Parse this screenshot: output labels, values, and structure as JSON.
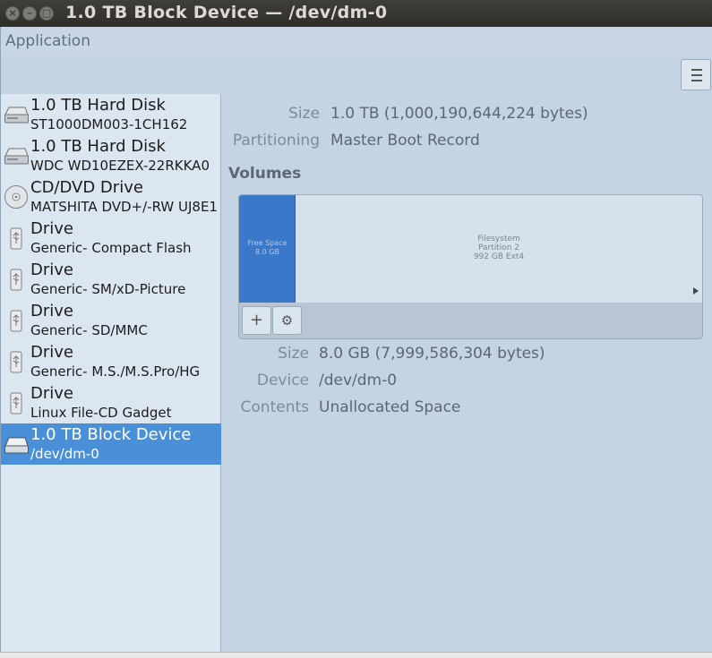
{
  "window": {
    "title": "1.0 TB Block Device — /dev/dm-0",
    "close_glyph": "×",
    "min_glyph": "–",
    "max_glyph": "□"
  },
  "menubar": {
    "application": "Application"
  },
  "sidebar": {
    "devices": [
      {
        "name": "1.0 TB Hard Disk",
        "sub": "ST1000DM003-1CH162",
        "icon": "hard-disk-icon"
      },
      {
        "name": "1.0 TB Hard Disk",
        "sub": "WDC WD10EZEX-22RKKA0",
        "icon": "hard-disk-icon"
      },
      {
        "name": "CD/DVD Drive",
        "sub": "MATSHITA DVD+/-RW UJ8E1",
        "icon": "optical-disc-icon"
      },
      {
        "name": "Drive",
        "sub": "Generic- Compact Flash",
        "icon": "usb-drive-icon"
      },
      {
        "name": "Drive",
        "sub": "Generic- SM/xD-Picture",
        "icon": "usb-drive-icon"
      },
      {
        "name": "Drive",
        "sub": "Generic- SD/MMC",
        "icon": "usb-drive-icon"
      },
      {
        "name": "Drive",
        "sub": "Generic- M.S./M.S.Pro/HG",
        "icon": "usb-drive-icon"
      },
      {
        "name": "Drive",
        "sub": "Linux File-CD Gadget",
        "icon": "usb-drive-icon"
      },
      {
        "name": "1.0 TB Block Device",
        "sub": "/dev/dm-0",
        "icon": "block-device-icon",
        "selected": true
      }
    ]
  },
  "details": {
    "size_label": "Size",
    "size_value": "1.0 TB (1,000,190,644,224 bytes)",
    "partitioning_label": "Partitioning",
    "partitioning_value": "Master Boot Record",
    "volumes_title": "Volumes"
  },
  "volumes": {
    "free": {
      "line1": "Free Space",
      "line2": "8.0 GB"
    },
    "fs": {
      "line1": "Filesystem",
      "line2": "Partition 2",
      "line3": "992 GB Ext4"
    },
    "add_glyph": "+",
    "settings_glyph": "⚙"
  },
  "selected_volume": {
    "size_label": "Size",
    "size_value": "8.0 GB (7,999,586,304 bytes)",
    "device_label": "Device",
    "device_value": "/dev/dm-0",
    "contents_label": "Contents",
    "contents_value": "Unallocated Space"
  },
  "colors": {
    "selection": "#4a90d9",
    "free_space": "#3b78c9",
    "background": "#c5d4e3"
  }
}
